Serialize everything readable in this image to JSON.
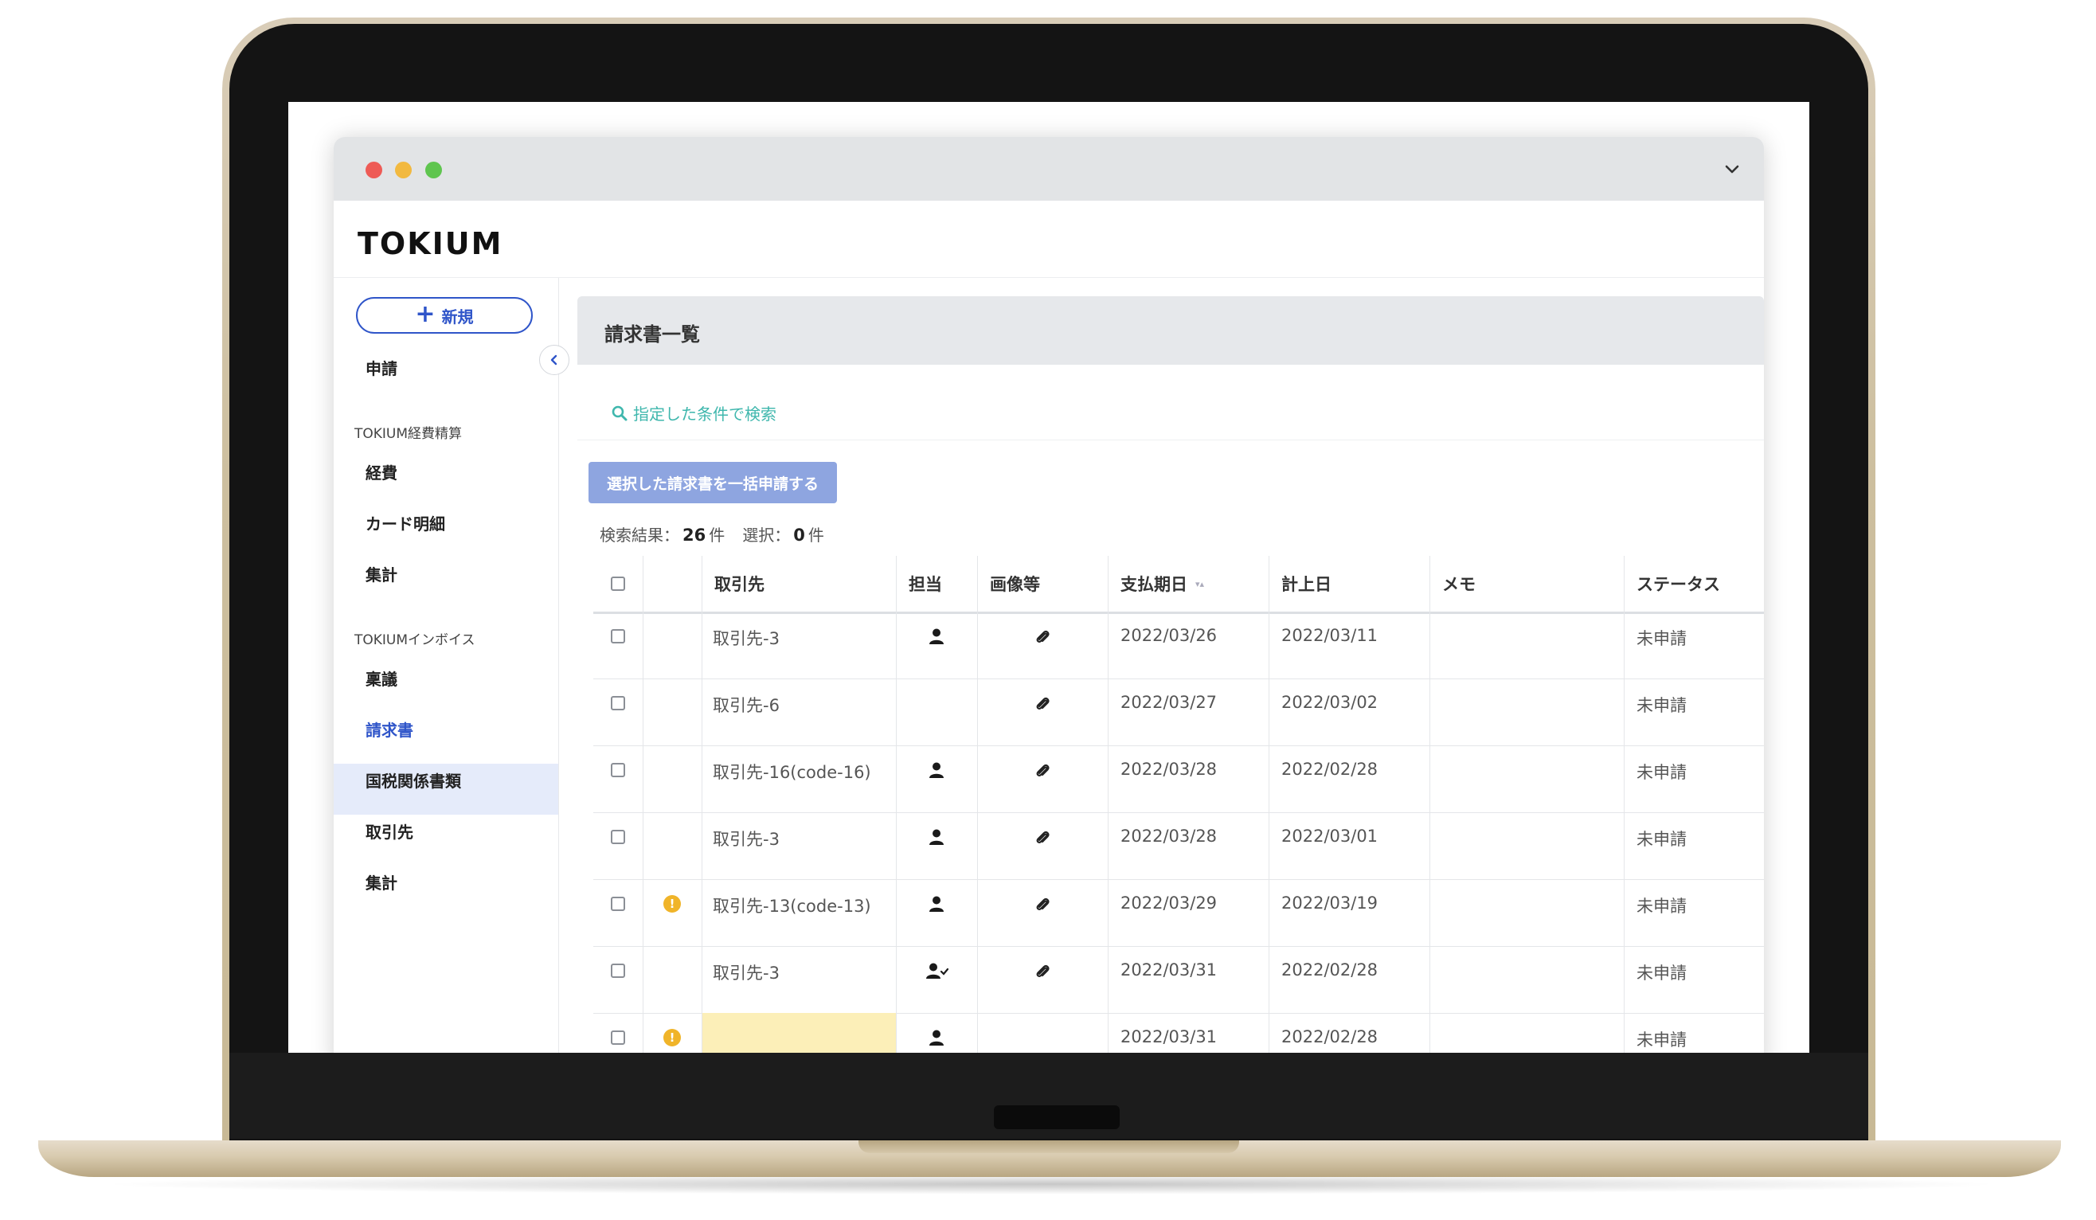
{
  "app": {
    "logo": "TOKIUM"
  },
  "sidebar": {
    "new_button_label": "新規",
    "items": [
      {
        "label": "申請",
        "type": "item"
      },
      {
        "label": "TOKIUM経費精算",
        "type": "group"
      },
      {
        "label": "経費",
        "type": "item"
      },
      {
        "label": "カード明細",
        "type": "item"
      },
      {
        "label": "集計",
        "type": "item"
      },
      {
        "label": "TOKIUMインボイス",
        "type": "group"
      },
      {
        "label": "稟議",
        "type": "item"
      },
      {
        "label": "請求書",
        "type": "item",
        "active": true
      },
      {
        "label": "国税関係書類",
        "type": "item"
      },
      {
        "label": "取引先",
        "type": "item"
      },
      {
        "label": "集計",
        "type": "item"
      }
    ]
  },
  "main": {
    "title": "請求書一覧",
    "search_link": "指定した条件で検索",
    "bulk_button": "選択した請求書を一括申請する",
    "results": {
      "label_results": "検索結果：",
      "count": "26",
      "unit": "件",
      "label_selected": "選択：",
      "selected": "0",
      "selected_unit": "件"
    }
  },
  "table": {
    "columns": [
      "",
      "",
      "取引先",
      "担当",
      "画像等",
      "支払期日",
      "計上日",
      "メモ",
      "ステータス"
    ],
    "rows": [
      {
        "warning": false,
        "vendor": "取引先-3",
        "assignee": "person",
        "attachment": true,
        "due": "2022/03/26",
        "booked": "2022/03/11",
        "memo": "",
        "status": "未申請"
      },
      {
        "warning": false,
        "vendor": "取引先-6",
        "assignee": "",
        "attachment": true,
        "due": "2022/03/27",
        "booked": "2022/03/02",
        "memo": "",
        "status": "未申請"
      },
      {
        "warning": false,
        "vendor": "取引先-16(code-16)",
        "assignee": "person",
        "attachment": true,
        "due": "2022/03/28",
        "booked": "2022/02/28",
        "memo": "",
        "status": "未申請"
      },
      {
        "warning": false,
        "vendor": "取引先-3",
        "assignee": "person",
        "attachment": true,
        "due": "2022/03/28",
        "booked": "2022/03/01",
        "memo": "",
        "status": "未申請"
      },
      {
        "warning": true,
        "vendor": "取引先-13(code-13)",
        "assignee": "person",
        "attachment": true,
        "due": "2022/03/29",
        "booked": "2022/03/19",
        "memo": "",
        "status": "未申請"
      },
      {
        "warning": false,
        "vendor": "取引先-3",
        "assignee": "person-check",
        "attachment": true,
        "due": "2022/03/31",
        "booked": "2022/02/28",
        "memo": "",
        "status": "未申請"
      },
      {
        "warning": true,
        "vendor": "",
        "vendor_missing": true,
        "assignee": "person",
        "attachment": false,
        "due": "2022/03/31",
        "booked": "2022/02/28",
        "memo": "",
        "status": "未申請"
      }
    ]
  },
  "colors": {
    "accent": "#2f55c9",
    "active_bg": "#e5ebfa",
    "search_link": "#3fb7ad",
    "bulk_button": "#8ea5e0",
    "warning": "#f0b429",
    "missing_vendor": "#fcefb8"
  }
}
